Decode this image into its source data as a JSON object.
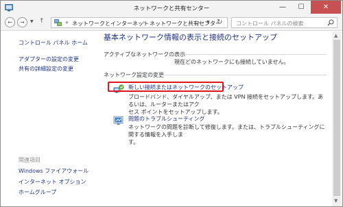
{
  "window": {
    "title": "ネットワークと共有センター",
    "controls": {
      "minimize": "—",
      "maximize": "☐",
      "close": "✕"
    }
  },
  "address": {
    "back": "←",
    "forward": "→",
    "dropdown": "▼",
    "up": "↑",
    "chevron": "«",
    "crumbs": [
      "ネットワークとインターネット",
      "ネットワークと共有センター"
    ],
    "separator": "›",
    "refresh": "↻",
    "search_placeholder": "コントロール パネルの検索"
  },
  "sidebar": {
    "home": "コントロール パネル ホーム",
    "links": [
      "アダプターの設定の変更",
      "共有の詳細設定の変更"
    ],
    "related_title": "関連項目",
    "related_links": [
      "Windows ファイアウォール",
      "インターネット オプション",
      "ホームグループ"
    ]
  },
  "main": {
    "heading": "基本ネットワーク情報の表示と接続のセットアップ",
    "active_section": "アクティブなネットワークの表示",
    "active_text": "現在どのネットワークにも接続していません。",
    "change_section": "ネットワーク設定の変更",
    "tasks": [
      {
        "link": "新しい接続またはネットワークのセットアップ",
        "desc_lines": [
          "ブロードバンド、ダイヤルアップ、または VPN 接続をセットアップします。あるいは、ルーターまたはアク",
          "セス ポイントをセットアップします。"
        ],
        "icon": "network-setup-icon"
      },
      {
        "link": "問題のトラブルシューティング",
        "desc_lines": [
          "ネットワークの問題を診断して修復します。または、トラブルシューティングに関する情報を入手しま",
          "す。"
        ],
        "icon": "troubleshoot-icon"
      }
    ]
  },
  "colors": {
    "link": "#1e3287",
    "highlight": "#e0161d",
    "close_button": "#c75050"
  }
}
